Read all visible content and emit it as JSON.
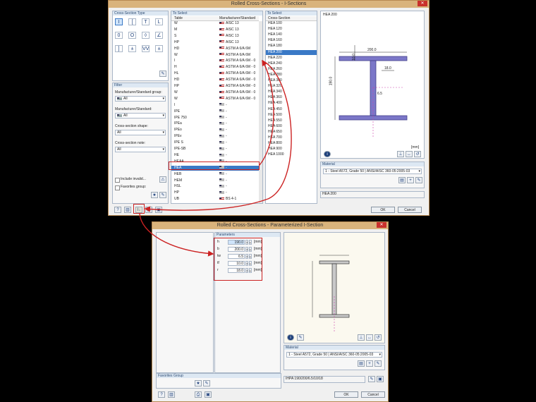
{
  "top": {
    "title": "Rolled Cross-Sections - I-Sections",
    "close": "✕",
    "type_panel_title": "Cross-Section Type",
    "type_buttons": [
      "I",
      "[",
      "T",
      "L",
      "0",
      "O",
      "◊",
      "∠",
      "]",
      "±",
      "VV",
      "±"
    ],
    "filter": {
      "title": "Filter",
      "manufacturer_group_label": "Manufacturer/Standard group:",
      "manufacturer_group_value": "All",
      "manufacturer_label": "Manufacturer/Standard:",
      "manufacturer_value": "All",
      "shape_label": "Cross-section shape:",
      "shape_value": "All",
      "note_label": "Cross-section note:",
      "note_value": "All",
      "include_invalid": "Include invalid...",
      "favorites_group": "Favorites group:"
    },
    "to_select_title": "To Select",
    "table_header": "Table",
    "manufacturer_header": "Manufacturer/Standard",
    "tables": [
      {
        "name": "W",
        "std": "AISC 13"
      },
      {
        "name": "M",
        "std": "AISC 13"
      },
      {
        "name": "S",
        "std": "AISC 13"
      },
      {
        "name": "HP",
        "std": "AISC 13"
      },
      {
        "name": "HD",
        "std": "ASTM A 6/A 6M"
      },
      {
        "name": "W",
        "std": "ASTM A 6/A 6M"
      },
      {
        "name": "I",
        "std": "ASTM A 6/A 6M - 0"
      },
      {
        "name": "H",
        "std": "ASTM A 6/A 6M - 0"
      },
      {
        "name": "HL",
        "std": "ASTM A 6/A 6M - 0"
      },
      {
        "name": "HD",
        "std": "ASTM A 6/A 6M - 0"
      },
      {
        "name": "HP",
        "std": "ASTM A 6/A 6M - 0"
      },
      {
        "name": "W",
        "std": "ASTM A 6/A 6M - 0"
      },
      {
        "name": "W",
        "std": "ASTM A 6/A 6M - 0"
      },
      {
        "name": "I",
        "std": "-"
      },
      {
        "name": "IPE",
        "std": "-"
      },
      {
        "name": "IPE 750",
        "std": "-"
      },
      {
        "name": "IPEa",
        "std": "-"
      },
      {
        "name": "IPEo",
        "std": "-"
      },
      {
        "name": "IPEv",
        "std": "-"
      },
      {
        "name": "IPE S",
        "std": "-"
      },
      {
        "name": "IPE-SB",
        "std": "-"
      },
      {
        "name": "HE",
        "std": "-"
      },
      {
        "name": "HEAA",
        "std": "-"
      },
      {
        "name": "HEA",
        "std": "-"
      },
      {
        "name": "HEB",
        "std": "-"
      },
      {
        "name": "HEM",
        "std": "-"
      },
      {
        "name": "HSL",
        "std": "-"
      },
      {
        "name": "HP",
        "std": "-"
      },
      {
        "name": "UB",
        "std": "BS 4-1"
      }
    ],
    "selected_table_index": 23,
    "section_panel_title": "To Select",
    "section_header": "Cross-Section",
    "sections": [
      "HEA 100",
      "HEA 120",
      "HEA 140",
      "HEA 160",
      "HEA 180",
      "HEA 200",
      "HEA 220",
      "HEA 240",
      "HEA 260",
      "HEA 280",
      "HEA 300",
      "HEA 320",
      "HEA 340",
      "HEA 360",
      "HEA 400",
      "HEA 450",
      "HEA 500",
      "HEA 550",
      "HEA 600",
      "HEA 650",
      "HEA 700",
      "HEA 800",
      "HEA 900",
      "HEA 1000"
    ],
    "selected_section_index": 5,
    "preview_title": "HEA 200",
    "dims": {
      "width": "200.0",
      "flange": "10.0",
      "tw": "6.5",
      "height": "190.0",
      "r": "18.0"
    },
    "units": "[mm]",
    "material_title": "Material",
    "material_value": "1 - Steel A572, Grade 50 | ANSI/AISC 360-05:2005-03",
    "name_field": "HEA 200",
    "ok": "OK",
    "cancel": "Cancel"
  },
  "bottom": {
    "title": "Rolled Cross-Sections - Parameterized I-Section",
    "close": "✕",
    "params_title": "Parameters",
    "params": [
      {
        "sym": "h",
        "value": "190.0",
        "unit": "[mm]"
      },
      {
        "sym": "b",
        "value": "200.0",
        "unit": "[mm]"
      },
      {
        "sym": "tw",
        "value": "6.5",
        "unit": "[mm]"
      },
      {
        "sym": "tf",
        "value": "10.0",
        "unit": "[mm]"
      },
      {
        "sym": "r",
        "value": "18.0",
        "unit": "[mm]"
      }
    ],
    "favorites_group": "Favorites Group",
    "material_title": "Material",
    "material_value": "1 - Steel A572, Grade 50 | ANSI/AISC 360-05:2005-03",
    "name_field": "IHPA 190/200/6.5/10/18",
    "ok": "OK",
    "cancel": "Cancel"
  },
  "colors": {
    "highlight": "#cc2222",
    "selection": "#3a79c6",
    "title_bar": "#d9b37c"
  }
}
